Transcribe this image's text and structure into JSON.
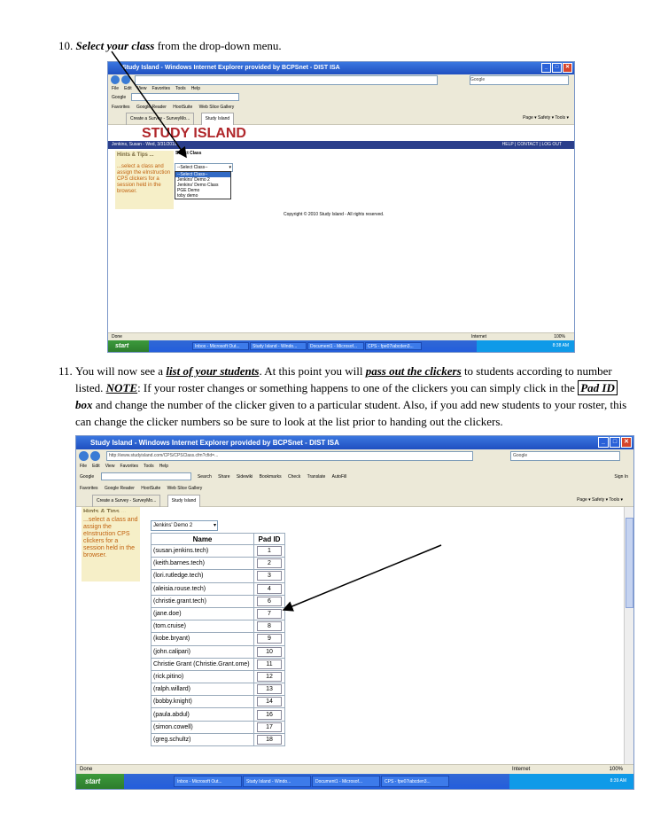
{
  "step10": {
    "number": "10.",
    "emph": "Select your class",
    "rest": " from the drop-down menu."
  },
  "step11": {
    "number": "11.",
    "t1": "You will now see a ",
    "e1": "list of your students",
    "t2": ".  At this point you will ",
    "e2": "pass out the clickers",
    "t3": " to students according to number listed.  ",
    "e3": "NOTE",
    "t4": ":  If your roster changes or something happens to one of the clickers you can simply click in the ",
    "e4": "Pad ID",
    "e5": "box",
    "t5": " and change the number of the clicker given to a particular student.  Also, if you add new students to your roster, this can change the clicker numbers so be sure to look at the list prior to handing out the clickers."
  },
  "shot1": {
    "title": "Study Island - Windows Internet Explorer provided by BCPSnet - DIST ISA",
    "menu": [
      "File",
      "Edit",
      "View",
      "Favorites",
      "Tools",
      "Help"
    ],
    "google": "Google",
    "favorites": "Favorites",
    "google_reader": "Google Reader",
    "hootsuite": "HootSuite",
    "web_slice": "Web Slice Gallery",
    "tab1": "Create a Survey - SurveyMo...",
    "tab2": "Study Island",
    "tools_right": "Page ▾  Safety ▾  Tools ▾",
    "brand": "STUDY ISLAND",
    "user": "Jenkins, Susan - Wed, 3/31/2010",
    "top_links": "HELP | CONTACT | LOG OUT",
    "hints_title": "Hints & Tips ...",
    "hints_body": "...select a class and assign the eInstruction CPS clickers for a session held in the browser.",
    "select_label": "Select Class",
    "select_value": "--Select Class--",
    "options": [
      "--Select Class--",
      "Jenkins' Demo 2",
      "Jenkins' Demo Class",
      "PGE Demo",
      "toby demo"
    ],
    "copyright": "Copyright © 2010 Study Island - All rights reserved.",
    "status": "Done",
    "zone": "Internet",
    "zoom": "100%",
    "start": "start",
    "tasks": [
      "Inbox - Microsoft Out...",
      "Study Island - Windo...",
      "Document1 - Microsof...",
      "CPS - fpe07iabcden3..."
    ],
    "clock": "8:38 AM"
  },
  "shot2": {
    "title": "Study Island - Windows Internet Explorer provided by BCPSnet - DIST ISA",
    "url": "http://www.studyisland.com/CPS/CPSClass.cfm?cfid=...",
    "menu": [
      "File",
      "Edit",
      "View",
      "Favorites",
      "Tools",
      "Help"
    ],
    "google": "Google",
    "search": "Search",
    "share": "Share",
    "sidewiki": "Sidewiki",
    "bookmarks": "Bookmarks",
    "check": "Check",
    "translate": "Translate",
    "autofill": "AutoFill",
    "signin": "Sign In",
    "favorites": "Favorites",
    "google_reader": "Google Reader",
    "hootsuite": "HootSuite",
    "web_slice": "Web Slice Gallery",
    "tab1": "Create a Survey - SurveyMo...",
    "tab2": "Study Island",
    "tools_right": "Page ▾  Safety ▾  Tools ▾",
    "hints_title": "Hints & Tips ...",
    "hints_body": "...select a class and assign the eInstruction CPS clickers for a session held in the browser.",
    "class_value": "Jenkins' Demo 2",
    "col_name": "Name",
    "col_pad": "Pad ID",
    "students": [
      {
        "name": "(susan.jenkins.tech)",
        "pad": "1"
      },
      {
        "name": "(keith.barnes.tech)",
        "pad": "2"
      },
      {
        "name": "(lori.rutledge.tech)",
        "pad": "3"
      },
      {
        "name": "(aleisia.rouse.tech)",
        "pad": "4"
      },
      {
        "name": "(christie.grant.tech)",
        "pad": "6"
      },
      {
        "name": "(jane.doe)",
        "pad": "7"
      },
      {
        "name": "(tom.cruise)",
        "pad": "8"
      },
      {
        "name": "(kobe.bryant)",
        "pad": "9"
      },
      {
        "name": "(john.calipari)",
        "pad": "10"
      },
      {
        "name": "Christie Grant (Christie.Grant.ome)",
        "pad": "11"
      },
      {
        "name": "(rick.pitino)",
        "pad": "12"
      },
      {
        "name": "(ralph.willard)",
        "pad": "13"
      },
      {
        "name": "(bobby.knight)",
        "pad": "14"
      },
      {
        "name": "(paula.abdul)",
        "pad": "16"
      },
      {
        "name": "(simon.cowell)",
        "pad": "17"
      },
      {
        "name": "(greg.schultz)",
        "pad": "18"
      }
    ],
    "status": "Done",
    "zone": "Internet",
    "zoom": "100%",
    "start": "start",
    "tasks": [
      "Inbox - Microsoft Out...",
      "Study Island - Windo...",
      "Document1 - Microsof...",
      "CPS - fpe07iabcden3..."
    ],
    "clock": "8:39 AM"
  }
}
